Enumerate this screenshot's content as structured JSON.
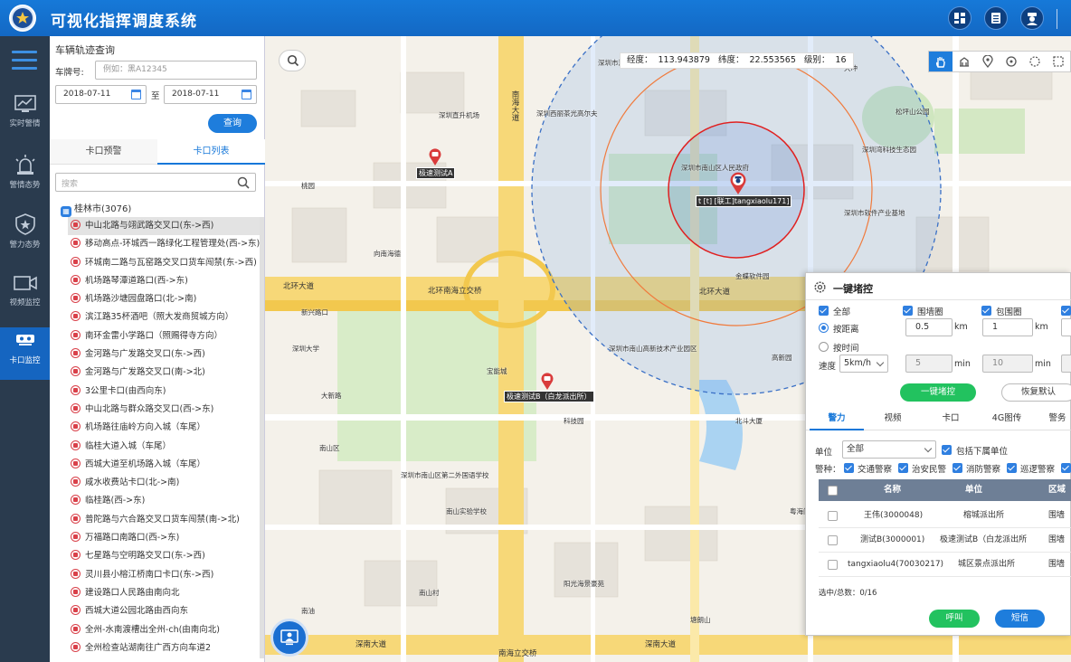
{
  "app": {
    "title": "可视化指挥调度系统"
  },
  "nav": {
    "items": [
      "实时警情",
      "警情态势",
      "警力态势",
      "视频监控",
      "卡口监控"
    ]
  },
  "panel": {
    "title": "车辆轨迹查询",
    "plate_label": "车牌号:",
    "plate_placeholder": "例如：黑A12345",
    "date_from": "2018-07-11",
    "date_sep": "至",
    "date_to": "2018-07-11",
    "query_button": "查询",
    "tabs": [
      "卡口预警",
      "卡口列表"
    ],
    "search_placeholder": "搜索",
    "tree_root": "桂林市(3076)",
    "checkpoints": [
      "中山北路与翊武路交叉口(东->西)",
      "移动高点-环城西一路绿化工程管理处(西->东)",
      "环城南二路与瓦窑路交叉口货车闯禁(东->西)",
      "机场路琴潭道路口(西->东)",
      "机场路沙塘园盘路口(北->南)",
      "滨江路35杯酒吧（照大发商贸城方向）",
      "南环金雷小学路口（照赐得寺方向）",
      "金河路与广发路交叉口(东->西)",
      "金河路与广发路交叉口(南->北)",
      "3公里卡口(由西向东)",
      "中山北路与群众路交叉口(西->东)",
      "机场路往庙岭方向入城（车尾）",
      "临桂大道入城（车尾）",
      "西城大道至机场路入城（车尾）",
      "咸水收费站卡口(北->南)",
      "临桂路(西->东)",
      "普陀路与六合路交叉口货车闯禁(南->北)",
      "万福路口南路口(西->东)",
      "七星路与空明路交叉口(东->西)",
      "灵川县小榕江桥南口卡口(东->西)",
      "建设路口人民路由南向北",
      "西城大道公园北路由西向东",
      "全州-水南渡槽出全州-ch(由南向北)",
      "全州检查站湖南往广西方向车道2"
    ]
  },
  "map": {
    "coords": {
      "lng_label": "经度：",
      "lng": "113.943879",
      "lat_label": "纬度：",
      "lat": "22.553565",
      "level_label": "级别：",
      "level": "16"
    },
    "markers": [
      {
        "label": "极速测试A"
      },
      {
        "label": "t [t] [联工]tangxiaolu171]"
      },
      {
        "label": "极速测试B（白龙派出所）"
      }
    ],
    "roads": [
      "北环大道",
      "北环南海立交桥",
      "北环大道",
      "南海大道",
      "深南大道",
      "深南大道",
      "南海立交桥"
    ],
    "places": [
      "深圳市鸿达迅科技有限公司",
      "深圳直升机场",
      "金蝶软件园",
      "深圳市软件产业基地",
      "深圳大学",
      "南山区",
      "高新园",
      "大冲",
      "松坪山公园",
      "深圳湾科技生态园",
      "深圳市南山区人民政府",
      "桃园",
      "大新路",
      "南山村",
      "科技园",
      "深圳市南山区第二外国语学校",
      "茶光",
      "塘朗山",
      "南山实验学校",
      "宝能城",
      "新兴路口",
      "深圳西丽茶光高尔夫",
      "深圳市南山高新技术产业园区",
      "粤海门",
      "阳光海景豪苑",
      "南油",
      "向南海德",
      "北斗大厦"
    ]
  },
  "dialog": {
    "title": "一键堵控",
    "all_label": "全部",
    "wall_label": "围墙圈",
    "surround_label": "包围圈",
    "by_distance": "按距离",
    "by_time": "按时间",
    "dist1": "0.5",
    "dist2": "1",
    "km": "km",
    "speed_label": "速度",
    "speed": "5km/h",
    "time1": "5",
    "time2": "10",
    "min": "min",
    "control_button": "一键堵控",
    "reset_button": "恢复默认",
    "tabs": [
      "警力",
      "视频",
      "卡口",
      "4G图传",
      "警务"
    ],
    "unit_label": "单位",
    "unit_value": "全部",
    "include_sub": "包括下属单位",
    "police_label": "警种：",
    "police_types": [
      "交通警察",
      "治安民警",
      "消防警察",
      "巡逻警察"
    ],
    "columns": [
      "名称",
      "单位",
      "区域"
    ],
    "rows": [
      {
        "name": "王伟(3000048)",
        "unit": "榕城派出所",
        "area": "围墙"
      },
      {
        "name": "测试B(3000001)",
        "unit": "极速测试B（白龙派出所",
        "area": "围墙"
      },
      {
        "name": "tangxiaolu4(70030217)",
        "unit": "城区景点派出所",
        "area": "围墙"
      }
    ],
    "summary": "选中/总数：0/16",
    "call_button": "呼叫",
    "sms_button": "短信"
  }
}
